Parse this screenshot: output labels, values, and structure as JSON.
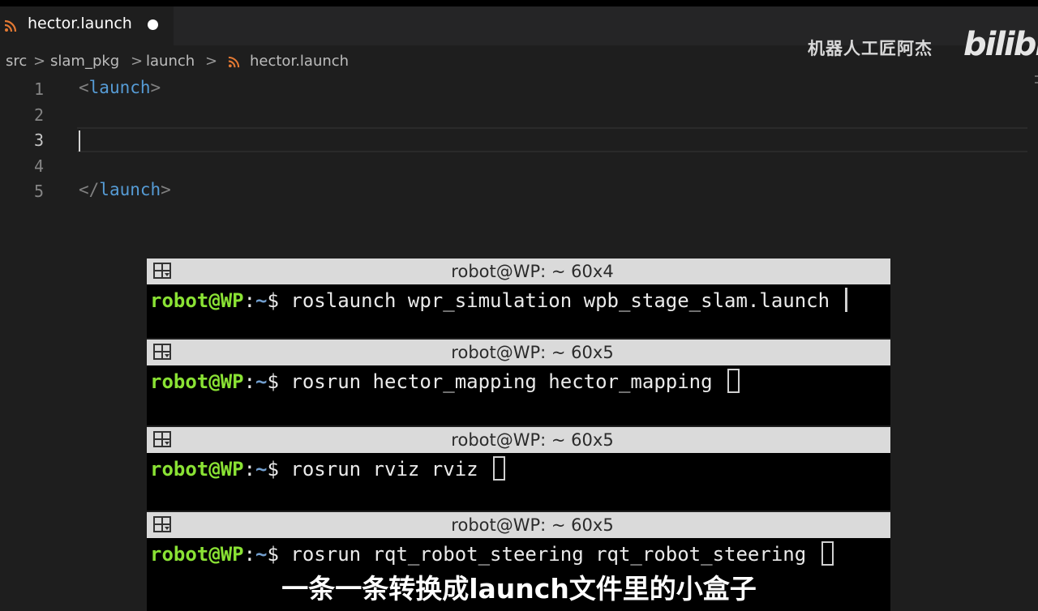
{
  "editor": {
    "tab": {
      "label": "hector.launch",
      "icon": "rss-icon",
      "modified": true
    },
    "breadcrumb": [
      "src",
      "slam_pkg",
      "launch",
      "hector.launch"
    ],
    "breadcrumb_separator": ">",
    "line_numbers": [
      "1",
      "2",
      "3",
      "4",
      "5"
    ],
    "active_line": "3",
    "code": {
      "line1": {
        "open": "<",
        "tag": "launch",
        "close": ">"
      },
      "line5": {
        "open": "</",
        "tag": "launch",
        "close": ">"
      }
    },
    "colors": {
      "tag": "#569cd6",
      "punct": "#808080",
      "icon": "#e37933"
    }
  },
  "watermark": {
    "text": "机器人工匠阿杰",
    "logo": "bilibili"
  },
  "terminals": [
    {
      "title": "robot@WP: ~ 60x4",
      "user": "robot@WP",
      "colon": ":",
      "path": "~",
      "dollar": "$",
      "command": "roslaunch wpr_simulation wpb_stage_slam.launch",
      "cursor": "bar"
    },
    {
      "title": "robot@WP: ~ 60x5",
      "user": "robot@WP",
      "colon": ":",
      "path": "~",
      "dollar": "$",
      "command": "rosrun hector_mapping hector_mapping",
      "cursor": "block"
    },
    {
      "title": "robot@WP: ~ 60x5",
      "user": "robot@WP",
      "colon": ":",
      "path": "~",
      "dollar": "$",
      "command": "rosrun rviz rviz",
      "cursor": "block"
    },
    {
      "title": "robot@WP: ~ 60x5",
      "user": "robot@WP",
      "colon": ":",
      "path": "~",
      "dollar": "$",
      "command": "rosrun rqt_robot_steering rqt_robot_steering",
      "cursor": "block"
    }
  ],
  "subtitle": "一条一条转换成launch文件里的小盒子"
}
